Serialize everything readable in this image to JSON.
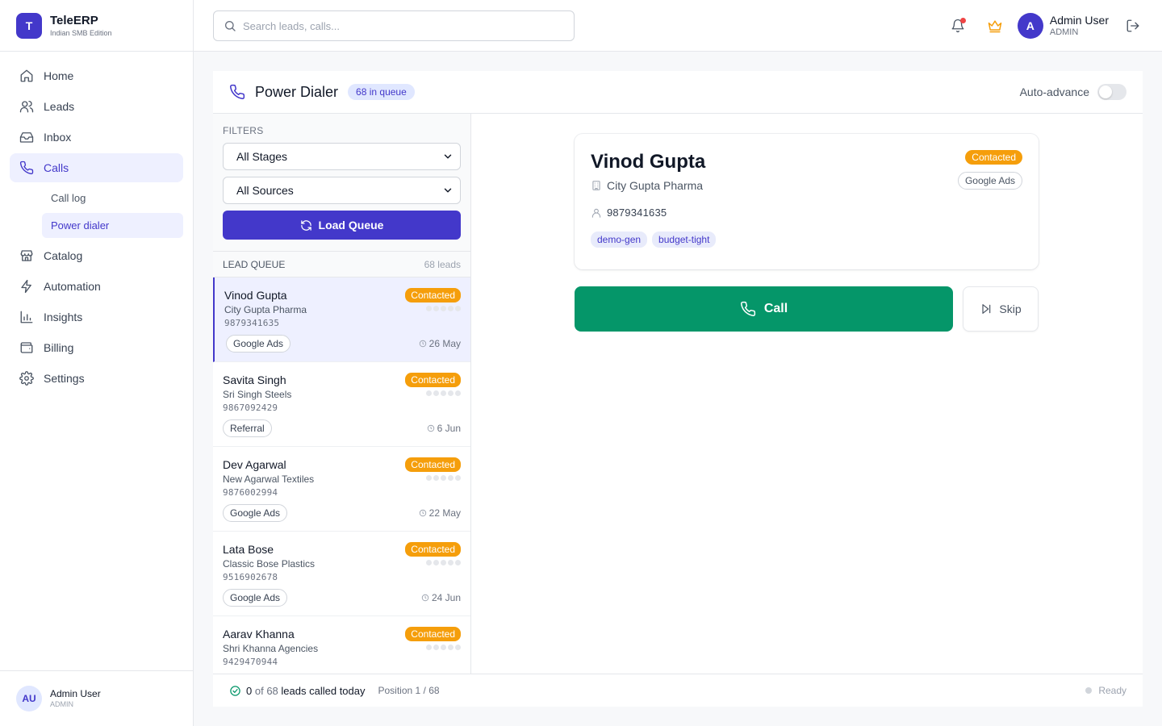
{
  "brand": {
    "logo_letter": "T",
    "name": "TeleERP",
    "edition": "Indian SMB Edition"
  },
  "nav": {
    "items": [
      {
        "label": "Home",
        "icon": "home-icon"
      },
      {
        "label": "Leads",
        "icon": "users-icon"
      },
      {
        "label": "Inbox",
        "icon": "inbox-icon"
      },
      {
        "label": "Calls",
        "icon": "phone-icon",
        "active": true
      },
      {
        "label": "Catalog",
        "icon": "store-icon"
      },
      {
        "label": "Automation",
        "icon": "zap-icon"
      },
      {
        "label": "Insights",
        "icon": "bar-chart-icon"
      },
      {
        "label": "Billing",
        "icon": "wallet-icon"
      },
      {
        "label": "Settings",
        "icon": "gear-icon"
      }
    ],
    "calls_sub": [
      {
        "label": "Call log"
      },
      {
        "label": "Power dialer",
        "active": true
      }
    ]
  },
  "sidebar_footer": {
    "initials": "AU",
    "name": "Admin User",
    "role": "ADMIN"
  },
  "topbar": {
    "search_placeholder": "Search leads, calls...",
    "user_initial": "A",
    "user_name": "Admin User",
    "user_role": "ADMIN"
  },
  "dialer": {
    "title": "Power Dialer",
    "queue_badge": "68 in queue",
    "auto_advance_label": "Auto-advance",
    "auto_advance_on": false
  },
  "filters": {
    "label": "FILTERS",
    "stage_selected": "All Stages",
    "source_selected": "All Sources",
    "load_button": "Load Queue"
  },
  "queue": {
    "label": "LEAD QUEUE",
    "count": "68 leads",
    "leads": [
      {
        "name": "Vinod Gupta",
        "company": "City Gupta Pharma",
        "phone": "9879341635",
        "status": "Contacted",
        "source": "Google Ads",
        "date": "26 May"
      },
      {
        "name": "Savita Singh",
        "company": "Sri Singh Steels",
        "phone": "9867092429",
        "status": "Contacted",
        "source": "Referral",
        "date": "6 Jun"
      },
      {
        "name": "Dev Agarwal",
        "company": "New Agarwal Textiles",
        "phone": "9876002994",
        "status": "Contacted",
        "source": "Google Ads",
        "date": "22 May"
      },
      {
        "name": "Lata Bose",
        "company": "Classic Bose Plastics",
        "phone": "9516902678",
        "status": "Contacted",
        "source": "Google Ads",
        "date": "24 Jun"
      },
      {
        "name": "Aarav Khanna",
        "company": "Shri Khanna Agencies",
        "phone": "9429470944",
        "status": "Contacted",
        "source": "",
        "date": ""
      }
    ]
  },
  "current": {
    "name": "Vinod Gupta",
    "company": "City Gupta Pharma",
    "phone": "9879341635",
    "status": "Contacted",
    "source": "Google Ads",
    "tags": [
      "demo-gen",
      "budget-tight"
    ],
    "call_label": "Call",
    "skip_label": "Skip"
  },
  "footer": {
    "called": "0",
    "of_text": "of",
    "total": "68",
    "suffix": "leads called today",
    "position": "Position 1 / 68",
    "status": "Ready"
  },
  "colors": {
    "accent": "#4338ca",
    "call_green": "#059669",
    "status_orange": "#f59e0b"
  }
}
